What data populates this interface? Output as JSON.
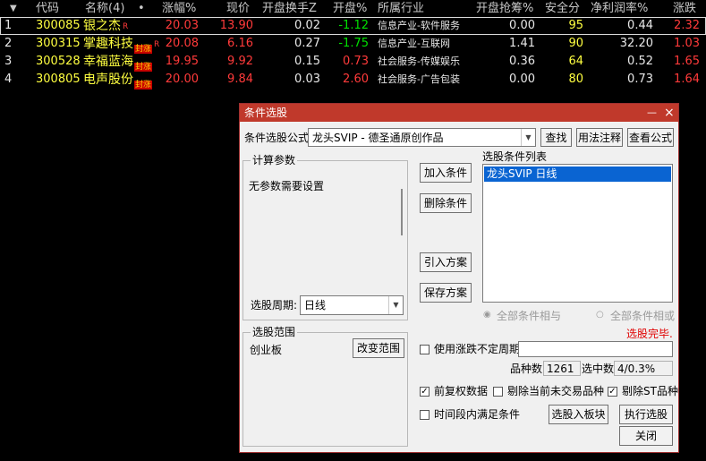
{
  "table": {
    "sort_indicator": "▼",
    "headers": {
      "code": "代码",
      "name": "名称",
      "name_count": "(4)",
      "dot": "•",
      "change_pct": "涨幅%",
      "price": "现价",
      "open_turnover": "开盘换手Z",
      "open_pct": "开盘%",
      "industry": "所属行业",
      "open_chip": "开盘抢筹%",
      "safety": "安全分",
      "net_margin": "净利润率%",
      "change": "涨跌"
    },
    "rows": [
      {
        "idx": "1",
        "code": "300085",
        "name": "银之杰",
        "tag": "",
        "rtag": "R",
        "change_pct": "20.03",
        "price": "13.90",
        "open_turnover": "0.02",
        "open_pct": "-1.12",
        "industry": "信息产业-软件服务",
        "open_chip": "0.00",
        "safety": "95",
        "net_margin": "0.44",
        "change": "2.32"
      },
      {
        "idx": "2",
        "code": "300315",
        "name": "掌趣科技",
        "tag": "封涨",
        "rtag": "R",
        "change_pct": "20.08",
        "price": "6.16",
        "open_turnover": "0.27",
        "open_pct": "-1.75",
        "industry": "信息产业-互联网",
        "open_chip": "1.41",
        "safety": "90",
        "net_margin": "32.20",
        "change": "1.03"
      },
      {
        "idx": "3",
        "code": "300528",
        "name": "幸福蓝海",
        "tag": "封涨",
        "rtag": "",
        "change_pct": "19.95",
        "price": "9.92",
        "open_turnover": "0.15",
        "open_pct": "0.73",
        "industry": "社会服务-传媒娱乐",
        "open_chip": "0.36",
        "safety": "64",
        "net_margin": "0.52",
        "change": "1.65"
      },
      {
        "idx": "4",
        "code": "300805",
        "name": "电声股份",
        "tag": "封涨",
        "rtag": "",
        "change_pct": "20.00",
        "price": "9.84",
        "open_turnover": "0.03",
        "open_pct": "2.60",
        "industry": "社会服务-广告包装",
        "open_chip": "0.00",
        "safety": "80",
        "net_margin": "0.73",
        "change": "1.64"
      }
    ]
  },
  "dialog": {
    "title": "条件选股",
    "minimize": "—",
    "close": "×",
    "formula_label": "条件选股公式",
    "formula_value": "龙头SVIP  -  德圣通原创作品",
    "btn_find": "查找",
    "btn_usage": "用法注释",
    "btn_view": "查看公式",
    "params_group": "计算参数",
    "params_text": "无参数需要设置",
    "period_label": "选股周期:",
    "period_value": "日线",
    "btn_add": "加入条件",
    "btn_delete": "删除条件",
    "btn_import": "引入方案",
    "btn_save": "保存方案",
    "cond_list_label": "选股条件列表",
    "cond_list_items": [
      "龙头SVIP  日线"
    ],
    "radio_and": "全部条件相与",
    "radio_or": "全部条件相或",
    "status_text": "选股完毕.",
    "range_group": "选股范围",
    "range_value": "创业板",
    "btn_change_range": "改变范围",
    "use_period_label": "使用涨跌不定周期",
    "stock_count_label": "品种数",
    "stock_count": "1261",
    "selected_label": "选中数",
    "selected_value": "4/0.3%",
    "chk_adjusted": "前复权数据",
    "chk_exclude_untraded": "剔除当前未交易品种",
    "chk_exclude_st": "剔除ST品种",
    "chk_time_range": "时间段内满足条件",
    "btn_to_block": "选股入板块",
    "btn_run": "执行选股",
    "btn_close": "关闭"
  },
  "colors": {
    "up": "#ff3a3a",
    "down": "#00e000",
    "title_bar": "#c0392b",
    "selection": "#0a64d2"
  }
}
